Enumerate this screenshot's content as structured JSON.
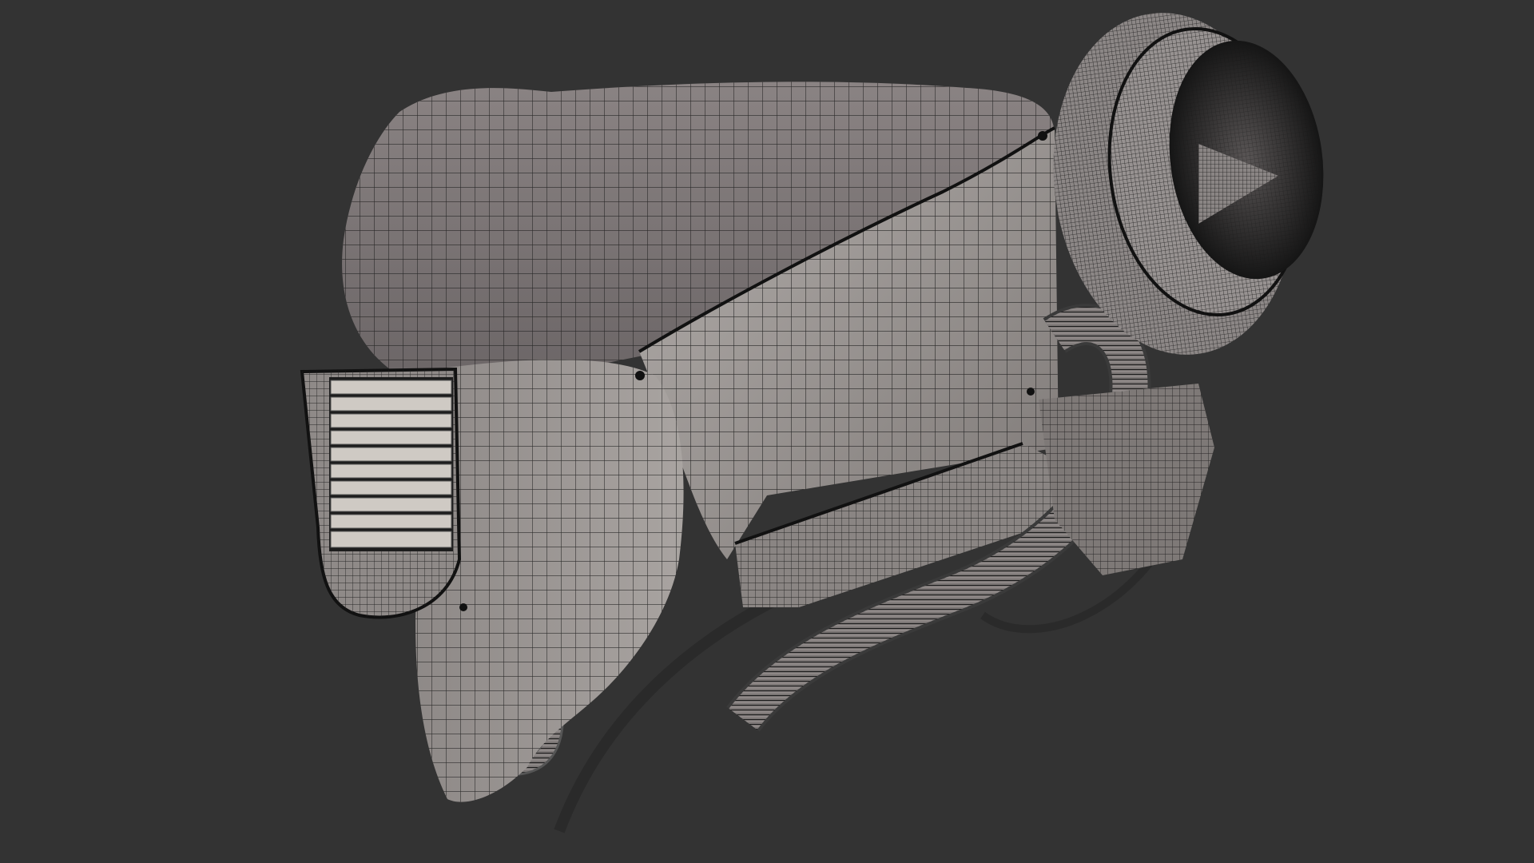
{
  "scene": {
    "background_color": "#333333",
    "subject": "wireframe-gas-mask-render",
    "mesh_color": "#8f8a89",
    "wire_color": "#1a1a1a",
    "vent_color": "#cfcac4"
  }
}
